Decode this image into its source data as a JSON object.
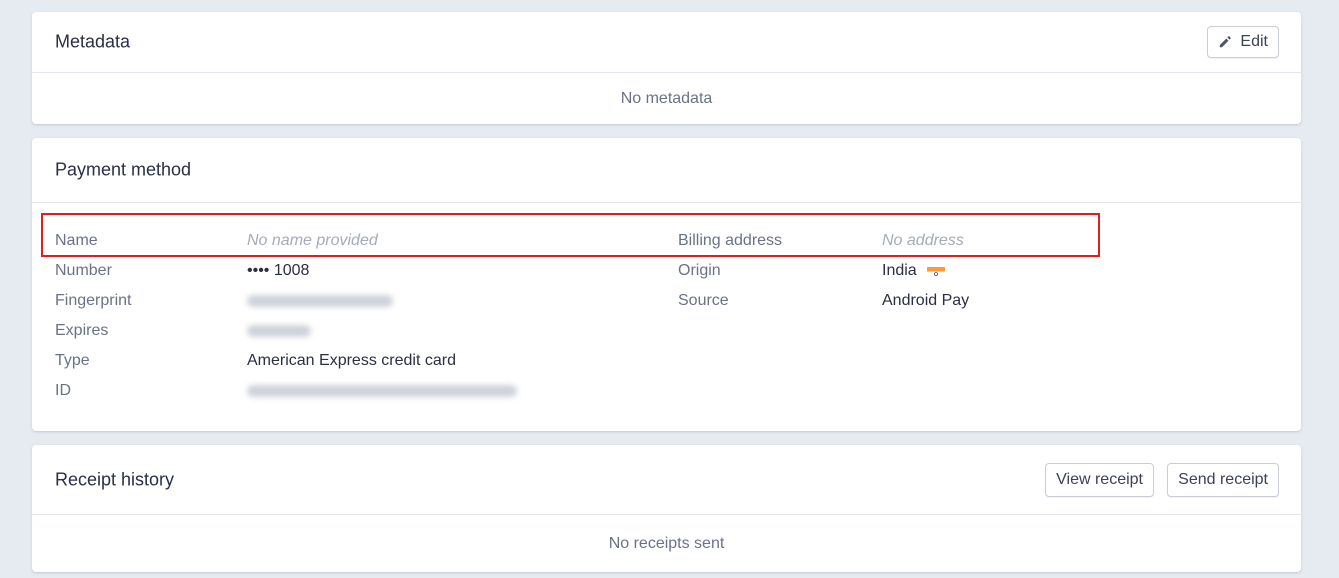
{
  "metadata": {
    "title": "Metadata",
    "edit_label": "Edit",
    "empty_text": "No metadata"
  },
  "payment_method": {
    "title": "Payment method",
    "left_fields": [
      {
        "label": "Name",
        "value": "No name provided"
      },
      {
        "label": "Number",
        "value": "•••• 1008"
      },
      {
        "label": "Fingerprint",
        "value": ""
      },
      {
        "label": "Expires",
        "value": ""
      },
      {
        "label": "Type",
        "value": "American Express credit card"
      },
      {
        "label": "ID",
        "value": ""
      }
    ],
    "right_fields": [
      {
        "label": "Billing address",
        "value": "No address"
      },
      {
        "label": "Origin",
        "value": "India"
      },
      {
        "label": "Source",
        "value": "Android Pay"
      }
    ],
    "origin_flag_icon": "india-flag-icon",
    "highlight_color": "#e01e1e"
  },
  "receipt_history": {
    "title": "Receipt history",
    "view_label": "View receipt",
    "send_label": "Send receipt",
    "empty_text": "No receipts sent"
  }
}
